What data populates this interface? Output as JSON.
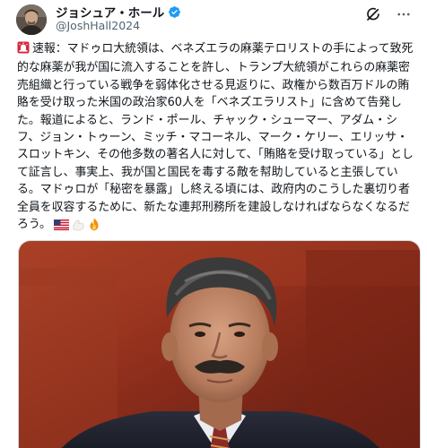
{
  "post": {
    "author": {
      "display_name": "ジョシュア・ホール",
      "handle": "@JoshHall2024",
      "verified": true,
      "verified_color": "#1d9bf0"
    },
    "header_icons": [
      "grok-icon",
      "more-icon"
    ],
    "text": {
      "prefix_emoji": "rotating-light-emoji",
      "body": "速報：マドゥロ大統領は、ベネズエラの麻薬テロリストの手によって致死的な麻薬が我が国に流入することを許し、トランプ大統領がこれらの麻薬密売組織と行っている戦争を弱体化させる見返りに、政権から数百万ドルの賄賂を受け取った米国の政治家60人を「ベネズエラリスト」に含めて告発した。報道によると、ランド・ポール、チャック・シューマー、アダム・シフ、ジョン・トゥーン、ミッチ・マコーネル、マーク・ケリー、エリッサ・スロットキン、その他多数の著名人に対して、「賄賂を受け取っている」として証言し、事実上、我が国と国民を毒する敵を幇助していると主張している。マドゥロが「秘密を暴露」し終える頃には、政府内のこうした裏切り者全員を収容するために、新たな連邦刑務所を建設しなければならなくなるだろう。",
      "suffix_emojis": [
        "us-flag-emoji",
        "flexed-biceps-emoji",
        "fire-emoji"
      ]
    },
    "media": {
      "type": "photo",
      "description_icon": "portrait-photo"
    }
  }
}
